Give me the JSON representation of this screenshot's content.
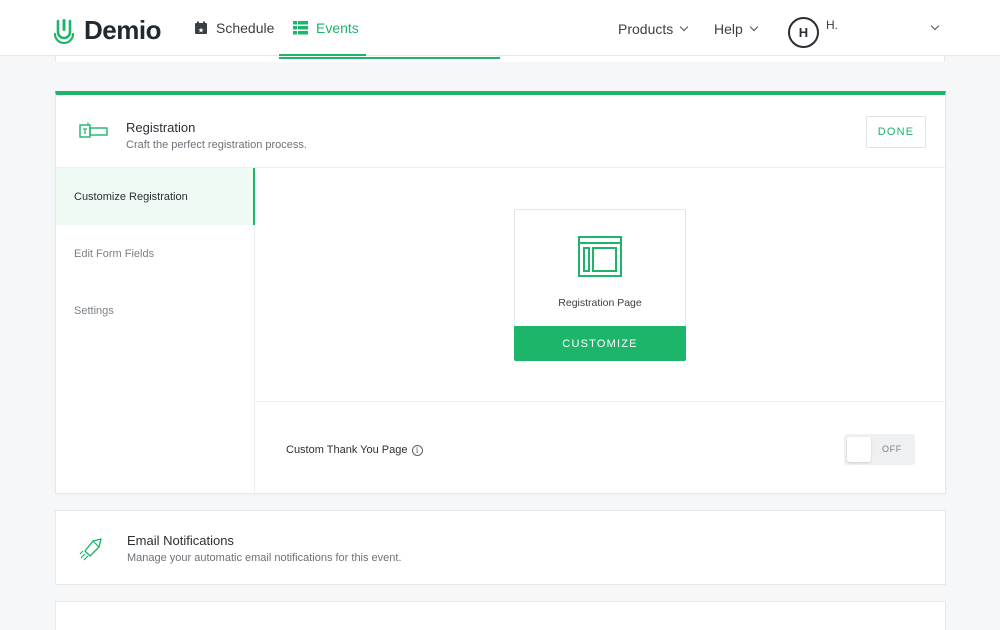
{
  "app": {
    "brand": "Demio",
    "accent_color": "#1cb56a"
  },
  "nav": {
    "schedule_label": "Schedule",
    "events_label": "Events",
    "products_label": "Products",
    "help_label": "Help",
    "avatar_initial": "H",
    "user_name": "H."
  },
  "registration": {
    "title": "Registration",
    "subtitle": "Craft the perfect registration process.",
    "done_label": "DONE",
    "sidebar": [
      {
        "label": "Customize Registration",
        "active": true
      },
      {
        "label": "Edit Form Fields",
        "active": false
      },
      {
        "label": "Settings",
        "active": false
      }
    ],
    "tile_label": "Registration Page",
    "customize_label": "CUSTOMIZE",
    "thank_you_label": "Custom Thank You Page",
    "info_glyph": "i",
    "toggle_state": "OFF"
  },
  "email": {
    "title": "Email Notifications",
    "subtitle": "Manage your automatic email notifications for this event."
  }
}
